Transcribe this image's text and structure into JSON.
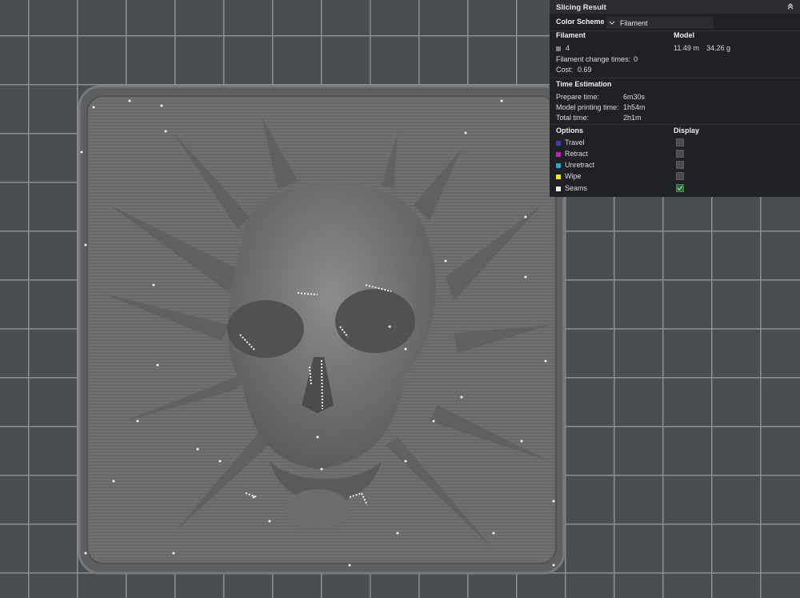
{
  "panel": {
    "title": "Slicing Result",
    "color_scheme_label": "Color Scheme",
    "color_scheme_value": "Filament",
    "table_header": {
      "left": "Filament",
      "right": "Model"
    },
    "filament": {
      "id": "4",
      "length": "11.49 m",
      "weight": "34.26 g",
      "change_times_label": "Filament change times:",
      "change_times_value": "0",
      "cost_label": "Cost:",
      "cost_value": "0.69",
      "swatch_color": "#808080"
    },
    "time_estimation": {
      "title": "Time Estimation",
      "rows": [
        {
          "label": "Prepare time:",
          "value": "6m30s"
        },
        {
          "label": "Model printing time:",
          "value": "1h54m"
        },
        {
          "label": "Total time:",
          "value": "2h1m"
        }
      ]
    },
    "options": {
      "header_left": "Options",
      "header_right": "Display",
      "items": [
        {
          "label": "Travel",
          "color": "#3b3fb8",
          "checked": false
        },
        {
          "label": "Retract",
          "color": "#c21fc6",
          "checked": false
        },
        {
          "label": "Unretract",
          "color": "#27a6d3",
          "checked": false
        },
        {
          "label": "Wipe",
          "color": "#f0e614",
          "checked": false
        },
        {
          "label": "Seams",
          "color": "#f2f2f2",
          "checked": true
        }
      ]
    }
  },
  "viewport": {
    "background_color": "#4b4e51",
    "model_color": "#6c6e70"
  }
}
